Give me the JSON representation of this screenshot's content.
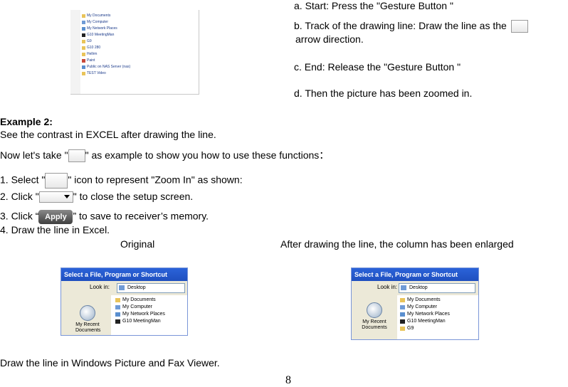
{
  "steps_top": {
    "a": "a. Start: Press the \"Gesture Button \"",
    "b_pre": "b. Track of the drawing line: Draw the line as the",
    "b_post": "arrow direction.",
    "c": "c. End: Release the \"Gesture Button \"",
    "d": "d. Then the picture has been zoomed in."
  },
  "explorer_thumb": {
    "items": [
      "My Documents",
      "My Computer",
      "My Network Places",
      "G10 MeetingMan",
      "G9",
      "G10 280",
      "Hellrm",
      "Paint",
      "Public on NAS Server (nas)",
      "TEST Video"
    ]
  },
  "example2": {
    "heading": "Example 2:",
    "line1": "See the contrast in EXCEL after drawing the line.",
    "line2_pre": "Now let's take \"",
    "line2_post": "\" as example to show you how to use these functions：",
    "step1_pre": "1. Select \"",
    "step1_post": "\" icon to represent \"Zoom In\" as shown:",
    "step2_pre": "2. Click \"",
    "step2_post": "\" to close the setup screen.",
    "step3_pre": "3. Click “",
    "step3_button": "Apply",
    "step3_post": "” to save to receiver’s memory.",
    "step4": "4. Draw the line in Excel.",
    "caption_original": "Original",
    "caption_after": "After drawing the line, the column has been enlarged"
  },
  "dialog_original": {
    "title": "Select a File, Program or Shortcut",
    "look_in_label": "Look in:",
    "look_in_value": "Desktop",
    "recent_label": "My Recent Documents",
    "files": [
      "My Documents",
      "My Computer",
      "My Network Places",
      "G10 MeetingMan"
    ]
  },
  "dialog_after": {
    "title": "Select a File, Program or Shortcut",
    "look_in_label": "Look in:",
    "look_in_value": "Desktop",
    "recent_label": "My Recent Documents",
    "files": [
      "My Documents",
      "My Computer",
      "My Network Places",
      "G10 MeetingMan",
      "G9"
    ]
  },
  "footer_text": "Draw the line in Windows Picture and Fax Viewer.",
  "page_number": "8",
  "colors": {
    "dialog_title": "#2b63d9",
    "dialog_panel": "#ece9d8",
    "link_text": "#1a3a8a"
  }
}
